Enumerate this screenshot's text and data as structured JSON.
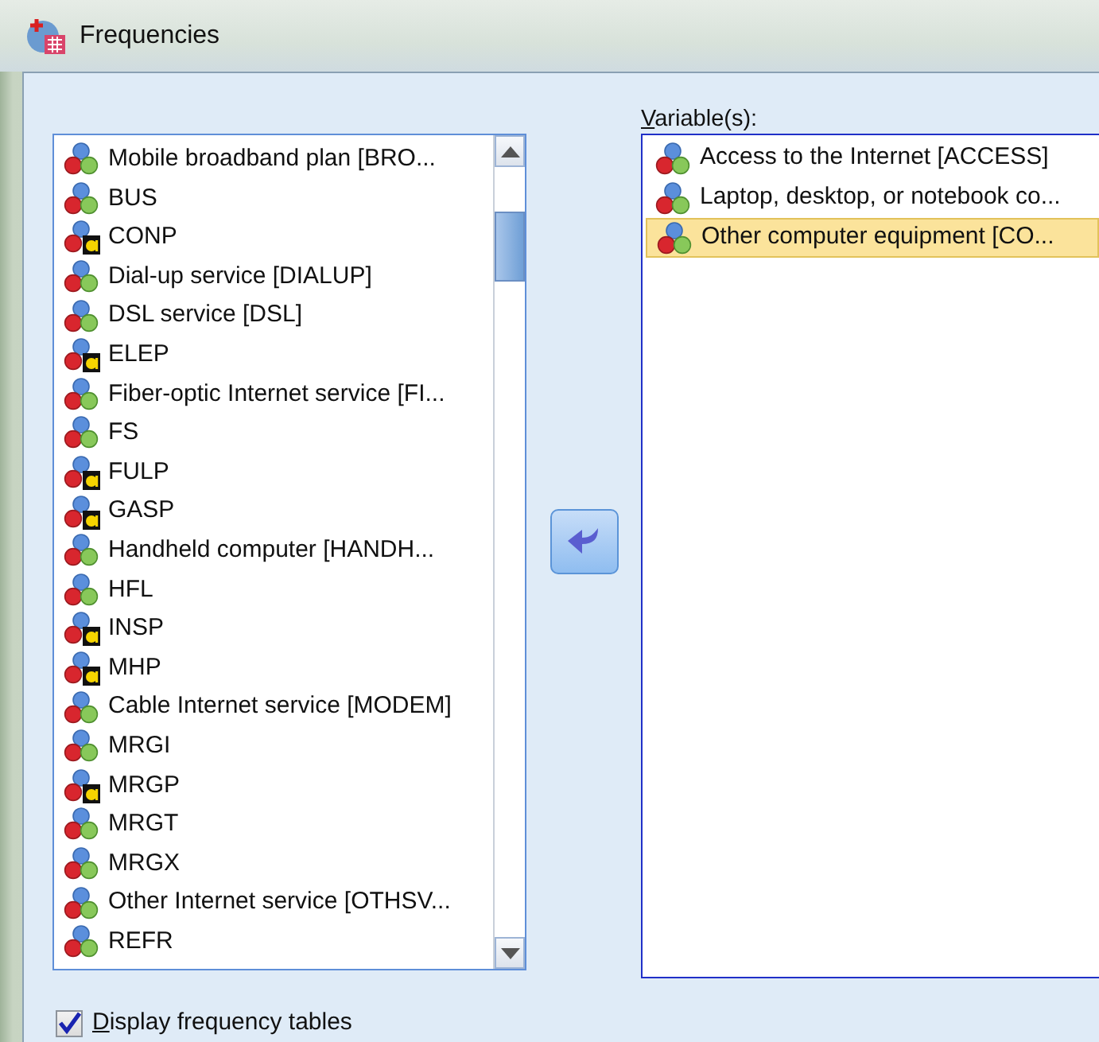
{
  "window": {
    "title": "Frequencies"
  },
  "source_list": {
    "items": [
      {
        "label": "Mobile broadband plan [BRO...",
        "kind": "scale"
      },
      {
        "label": "BUS",
        "kind": "scale"
      },
      {
        "label": "CONP",
        "kind": "string"
      },
      {
        "label": "Dial-up service [DIALUP]",
        "kind": "scale"
      },
      {
        "label": "DSL service [DSL]",
        "kind": "scale"
      },
      {
        "label": "ELEP",
        "kind": "string"
      },
      {
        "label": "Fiber-optic Internet service [FI...",
        "kind": "scale"
      },
      {
        "label": "FS",
        "kind": "scale"
      },
      {
        "label": "FULP",
        "kind": "string"
      },
      {
        "label": "GASP",
        "kind": "string"
      },
      {
        "label": "Handheld computer [HANDH...",
        "kind": "scale"
      },
      {
        "label": "HFL",
        "kind": "scale"
      },
      {
        "label": "INSP",
        "kind": "string"
      },
      {
        "label": "MHP",
        "kind": "string"
      },
      {
        "label": "Cable Internet service [MODEM]",
        "kind": "scale"
      },
      {
        "label": "MRGI",
        "kind": "scale"
      },
      {
        "label": "MRGP",
        "kind": "string"
      },
      {
        "label": "MRGT",
        "kind": "scale"
      },
      {
        "label": "MRGX",
        "kind": "scale"
      },
      {
        "label": "Other Internet service [OTHSV...",
        "kind": "scale"
      },
      {
        "label": "REFR",
        "kind": "scale"
      }
    ]
  },
  "variables": {
    "label": "Variable(s):",
    "underline_first": true,
    "items": [
      {
        "label": "Access to the Internet [ACCESS]",
        "kind": "scale",
        "selected": false
      },
      {
        "label": "Laptop, desktop, or notebook co...",
        "kind": "scale",
        "selected": false
      },
      {
        "label": "Other computer equipment [CO...",
        "kind": "scale",
        "selected": true
      }
    ]
  },
  "display_frequency_tables": {
    "label": "Display frequency tables",
    "underline_first": true,
    "checked": true
  }
}
